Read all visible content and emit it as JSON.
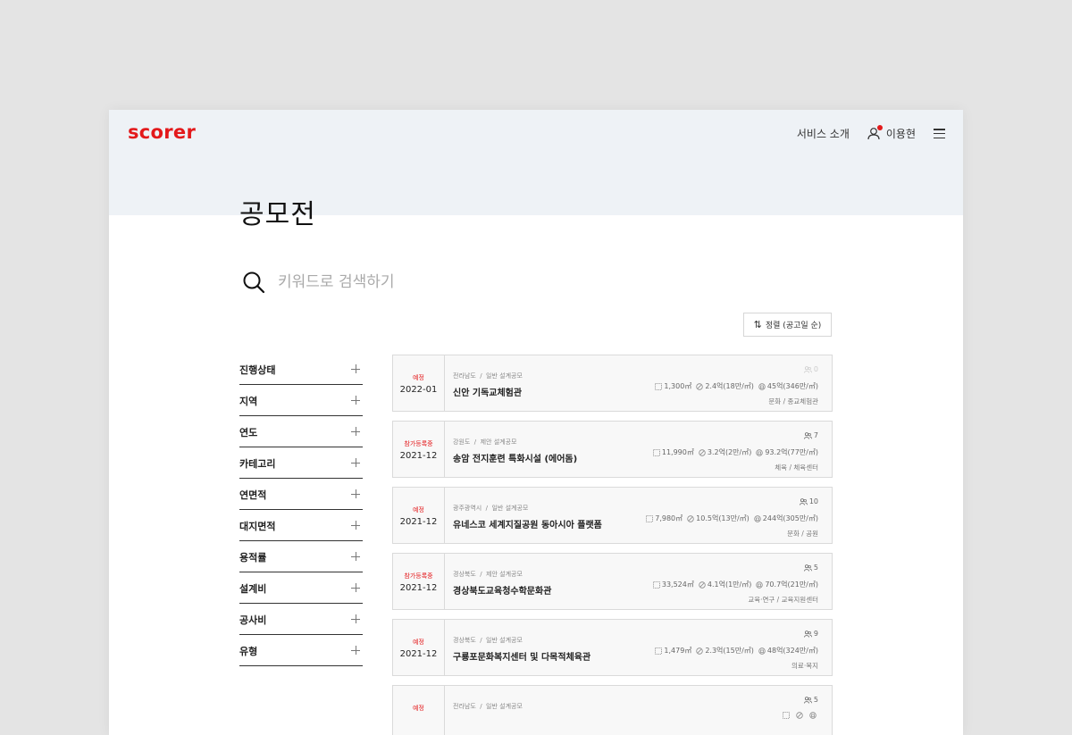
{
  "header": {
    "logo": "scorer",
    "service_link": "서비스 소개",
    "user_name": "이용현"
  },
  "page": {
    "title": "공모전"
  },
  "search": {
    "placeholder": "키워드로 검색하기"
  },
  "sort": {
    "label": "정렬 (공고일 순)"
  },
  "filters": [
    {
      "label": "진행상태"
    },
    {
      "label": "지역"
    },
    {
      "label": "연도"
    },
    {
      "label": "카테고리"
    },
    {
      "label": "연면적"
    },
    {
      "label": "대지면적"
    },
    {
      "label": "용적률"
    },
    {
      "label": "설계비"
    },
    {
      "label": "공사비"
    },
    {
      "label": "유형"
    }
  ],
  "competitions": [
    {
      "status": "예정",
      "date": "2022-01",
      "region": "전라남도",
      "type": "일반 설계공모",
      "title": "신안 기독교체험관",
      "area": "1,300㎡",
      "design_fee": "2.4억(18만/㎡)",
      "construction_cost": "45억(346만/㎡)",
      "category": "문화",
      "subcategory": "종교체험관",
      "participants": "0"
    },
    {
      "status": "참가등록중",
      "date": "2021-12",
      "region": "강원도",
      "type": "제안 설계공모",
      "title": "송암 전지훈련 특화시설 (에어돔)",
      "area": "11,990㎡",
      "design_fee": "3.2억(2만/㎡)",
      "construction_cost": "93.2억(77만/㎡)",
      "category": "체육",
      "subcategory": "체육센터",
      "participants": "7"
    },
    {
      "status": "예정",
      "date": "2021-12",
      "region": "광주광역시",
      "type": "일반 설계공모",
      "title": "유네스코 세계지질공원 동아시아 플랫폼",
      "area": "7,980㎡",
      "design_fee": "10.5억(13만/㎡)",
      "construction_cost": "244억(305만/㎡)",
      "category": "문화",
      "subcategory": "공원",
      "participants": "10"
    },
    {
      "status": "참가등록중",
      "date": "2021-12",
      "region": "경상북도",
      "type": "제안 설계공모",
      "title": "경상북도교육청수학문화관",
      "area": "33,524㎡",
      "design_fee": "4.1억(1만/㎡)",
      "construction_cost": "70.7억(21만/㎡)",
      "category": "교육·연구",
      "subcategory": "교육지원센터",
      "participants": "5"
    },
    {
      "status": "예정",
      "date": "2021-12",
      "region": "경상북도",
      "type": "일반 설계공모",
      "title": "구룡포문화복지센터 및 다목적체육관",
      "area": "1,479㎡",
      "design_fee": "2.3억(15만/㎡)",
      "construction_cost": "48억(324만/㎡)",
      "category": "의료·복지",
      "subcategory": "",
      "participants": "9"
    },
    {
      "status": "예정",
      "date": "",
      "region": "전라남도",
      "type": "일반 설계공모",
      "title": "",
      "area": "",
      "design_fee": "",
      "construction_cost": "",
      "category": "",
      "subcategory": "",
      "participants": "5"
    }
  ],
  "colors": {
    "brand": "#e3191b",
    "header_band": "#eef2f6",
    "background": "#e4e4e4"
  }
}
